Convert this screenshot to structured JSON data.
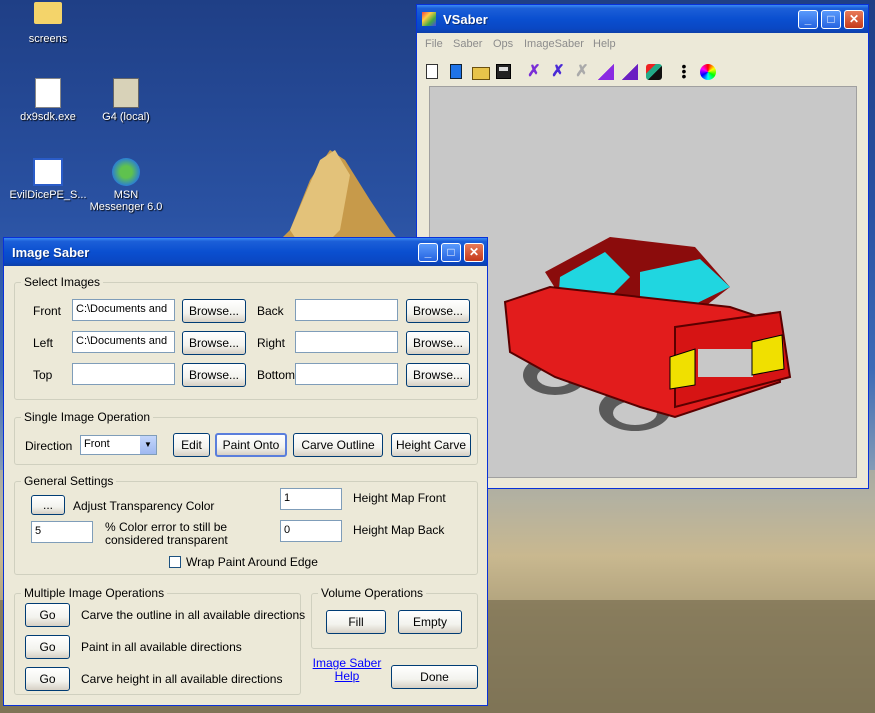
{
  "desktop": {
    "icons": [
      {
        "label": "screens"
      },
      {
        "label": "dx9sdk.exe"
      },
      {
        "label": "G4 (local)"
      },
      {
        "label": "EvilDicePE_S..."
      },
      {
        "label": "MSN Messenger 6.0"
      }
    ]
  },
  "vsaber": {
    "title": "VSaber",
    "menu": [
      "File",
      "Saber",
      "Ops",
      "ImageSaber",
      "Help"
    ],
    "toolbar": [
      "new-icon",
      "new-blue-icon",
      "open-icon",
      "save-icon",
      "carve-x-icon",
      "carve-x-alt-icon",
      "carve-x-gray-icon",
      "fill-purple-icon",
      "fill-purple-alt-icon",
      "paint-brush-icon",
      "dots-icon",
      "color-wheel-icon"
    ]
  },
  "imagesaber": {
    "title": "Image Saber",
    "select_images": {
      "group_label": "Select Images",
      "front_label": "Front",
      "front_value": "C:\\Documents and",
      "back_label": "Back",
      "back_value": "",
      "left_label": "Left",
      "left_value": "C:\\Documents and",
      "right_label": "Right",
      "right_value": "",
      "top_label": "Top",
      "top_value": "",
      "bottom_label": "Bottom",
      "bottom_value": "",
      "browse": "Browse..."
    },
    "single": {
      "group_label": "Single Image Operation",
      "direction_label": "Direction",
      "direction_value": "Front",
      "edit": "Edit",
      "paint_onto": "Paint Onto",
      "carve_outline": "Carve Outline",
      "height_carve": "Height Carve"
    },
    "general": {
      "group_label": "General Settings",
      "color_button": "...",
      "adjust_transparency": "Adjust Transparency Color",
      "color_error_value": "5",
      "color_error_text": "% Color error to still be considered transparent",
      "height_front_value": "1",
      "height_front_label": "Height Map Front",
      "height_back_value": "0",
      "height_back_label": "Height Map Back",
      "wrap_label": "Wrap  Paint  Around Edge"
    },
    "multiple": {
      "group_label": "Multiple Image Operations",
      "go": "Go",
      "carve_outline_all": "Carve the outline in all available directions",
      "paint_all": "Paint in all available directions",
      "carve_height_all": "Carve height in all available directions"
    },
    "volume": {
      "group_label": "Volume Operations",
      "fill": "Fill",
      "empty": "Empty"
    },
    "help_link": "Image Saber Help",
    "done": "Done"
  }
}
